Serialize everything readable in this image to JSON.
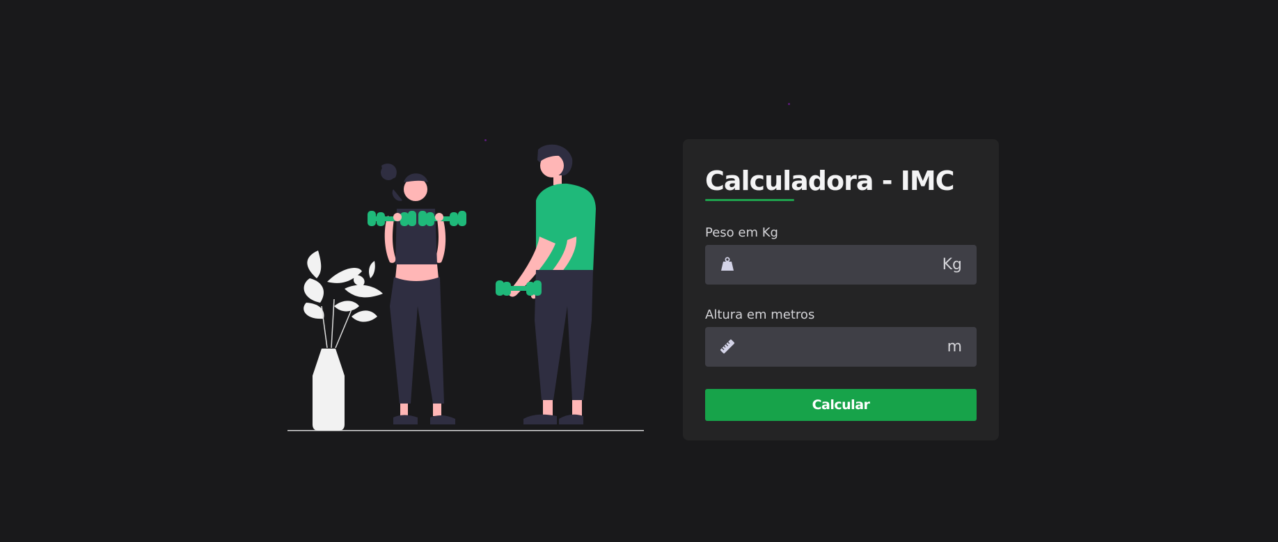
{
  "card": {
    "title": "Calculadora - IMC",
    "weight": {
      "label": "Peso em Kg",
      "unit": "Kg",
      "value": "",
      "icon": "weight-icon"
    },
    "height": {
      "label": "Altura em metros",
      "unit": "m",
      "value": "",
      "icon": "ruler-icon"
    },
    "submit_label": "Calcular"
  },
  "illustration": {
    "icon": "workout-illustration"
  },
  "colors": {
    "background": "#19191b",
    "card": "#242425",
    "input": "#3f3f46",
    "accent": "#17a34a",
    "figure_green": "#1fb97a"
  }
}
